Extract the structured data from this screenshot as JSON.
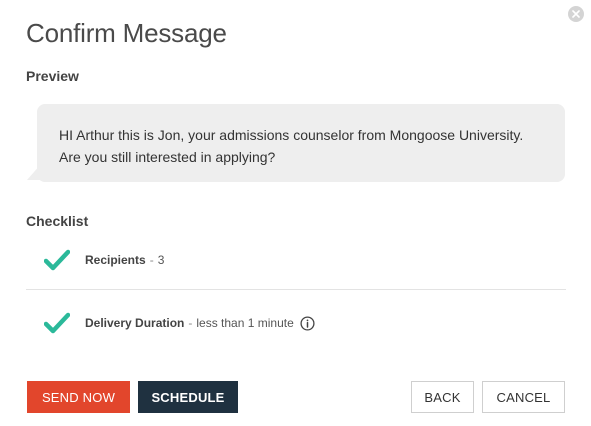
{
  "dialog": {
    "title": "Confirm Message"
  },
  "preview": {
    "label": "Preview",
    "message": "HI Arthur this is Jon, your admissions counselor from Mongoose University. Are you still interested in applying?"
  },
  "checklist": {
    "label": "Checklist",
    "items": [
      {
        "label": "Recipients",
        "separator": "-",
        "value": "3",
        "icon": "check-icon"
      },
      {
        "label": "Delivery Duration",
        "separator": "-",
        "value": "less than 1 minute",
        "icon": "check-icon",
        "info_icon": "info-icon"
      }
    ]
  },
  "buttons": {
    "send_now": "SEND NOW",
    "schedule": "SCHEDULE",
    "back": "BACK",
    "cancel": "CANCEL"
  },
  "colors": {
    "send_now_bg": "#e2462c",
    "schedule_bg": "#1f3140",
    "check_green": "#2bb99a",
    "bubble_bg": "#eeeeee"
  }
}
